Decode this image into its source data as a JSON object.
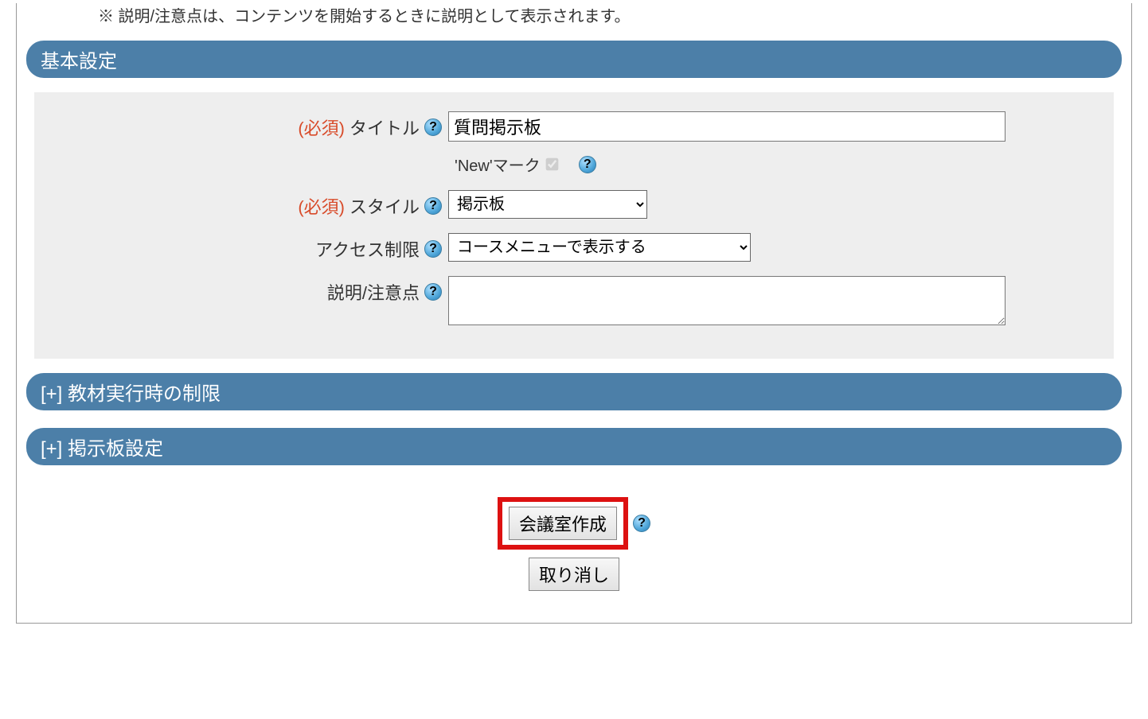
{
  "notes": {
    "line2": "※ 説明/注意点は、コンテンツを開始するときに説明として表示されます。"
  },
  "sections": {
    "basic": "基本設定",
    "exec_limit": "[+] 教材実行時の制限",
    "bbs_settings": "[+] 掲示板設定"
  },
  "form": {
    "required_label": "(必須)",
    "title_label": "タイトル",
    "title_value": "質問掲示板",
    "newmark_label": "'New'マーク",
    "newmark_checked": true,
    "style_label": "スタイル",
    "style_value": "掲示板",
    "style_options": [
      "掲示板"
    ],
    "access_label": "アクセス制限",
    "access_value": "コースメニューで表示する",
    "access_options": [
      "コースメニューで表示する"
    ],
    "desc_label": "説明/注意点",
    "desc_value": ""
  },
  "buttons": {
    "create": "会議室作成",
    "cancel": "取り消し"
  },
  "icons": {
    "help": "?"
  }
}
